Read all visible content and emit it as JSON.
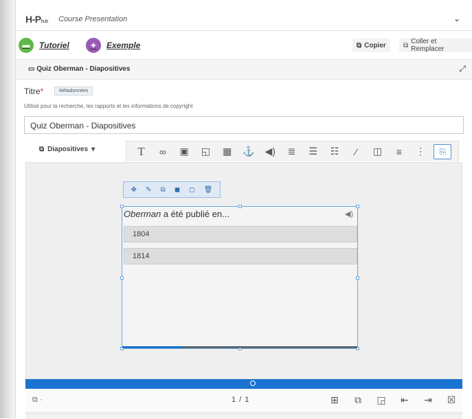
{
  "header": {
    "logo": "H-P",
    "logo_sub": "hub",
    "title": "Course Presentation",
    "collapse_icon": "chevron-down-icon"
  },
  "links": {
    "tutorial": "Tutoriel",
    "example": "Exemple",
    "copy": "Copier",
    "paste_replace": "Coller et Remplacer"
  },
  "section": {
    "title": "Quiz Oberman - Diapositives"
  },
  "form": {
    "title_label": "Titre",
    "required_mark": "*",
    "metadata_button": "Métadonnées",
    "help": "Utilisé pour la recherche, les rapports et les informations de copyright",
    "title_value": "Quiz Oberman - Diapositives"
  },
  "slides_menu": {
    "label": "Diapositives",
    "arrow": "▾"
  },
  "toolbar": {
    "icons": [
      "text-icon",
      "link-icon",
      "image-icon",
      "shapes-icon",
      "video-icon",
      "anchor-icon",
      "audio-icon",
      "fill-blanks-icon",
      "single-choice-icon",
      "multiple-choice-icon",
      "true-false-icon",
      "drag-drop-icon",
      "summary-icon",
      "more-icon",
      "paste-icon"
    ]
  },
  "question": {
    "title_italic": "Oberman",
    "title_rest": " a été publié en...",
    "answers": [
      "1804",
      "1814"
    ],
    "progress": 0.25
  },
  "footer": {
    "page": "1 / 1",
    "icons": [
      "new-slide-icon",
      "clone-slide-icon",
      "slide-background-icon",
      "move-slide-left-icon",
      "move-slide-right-icon",
      "delete-slide-icon"
    ]
  },
  "colors": {
    "accent": "#1a73d0",
    "tutorial": "#5fb84a",
    "example": "#9b59b6"
  }
}
